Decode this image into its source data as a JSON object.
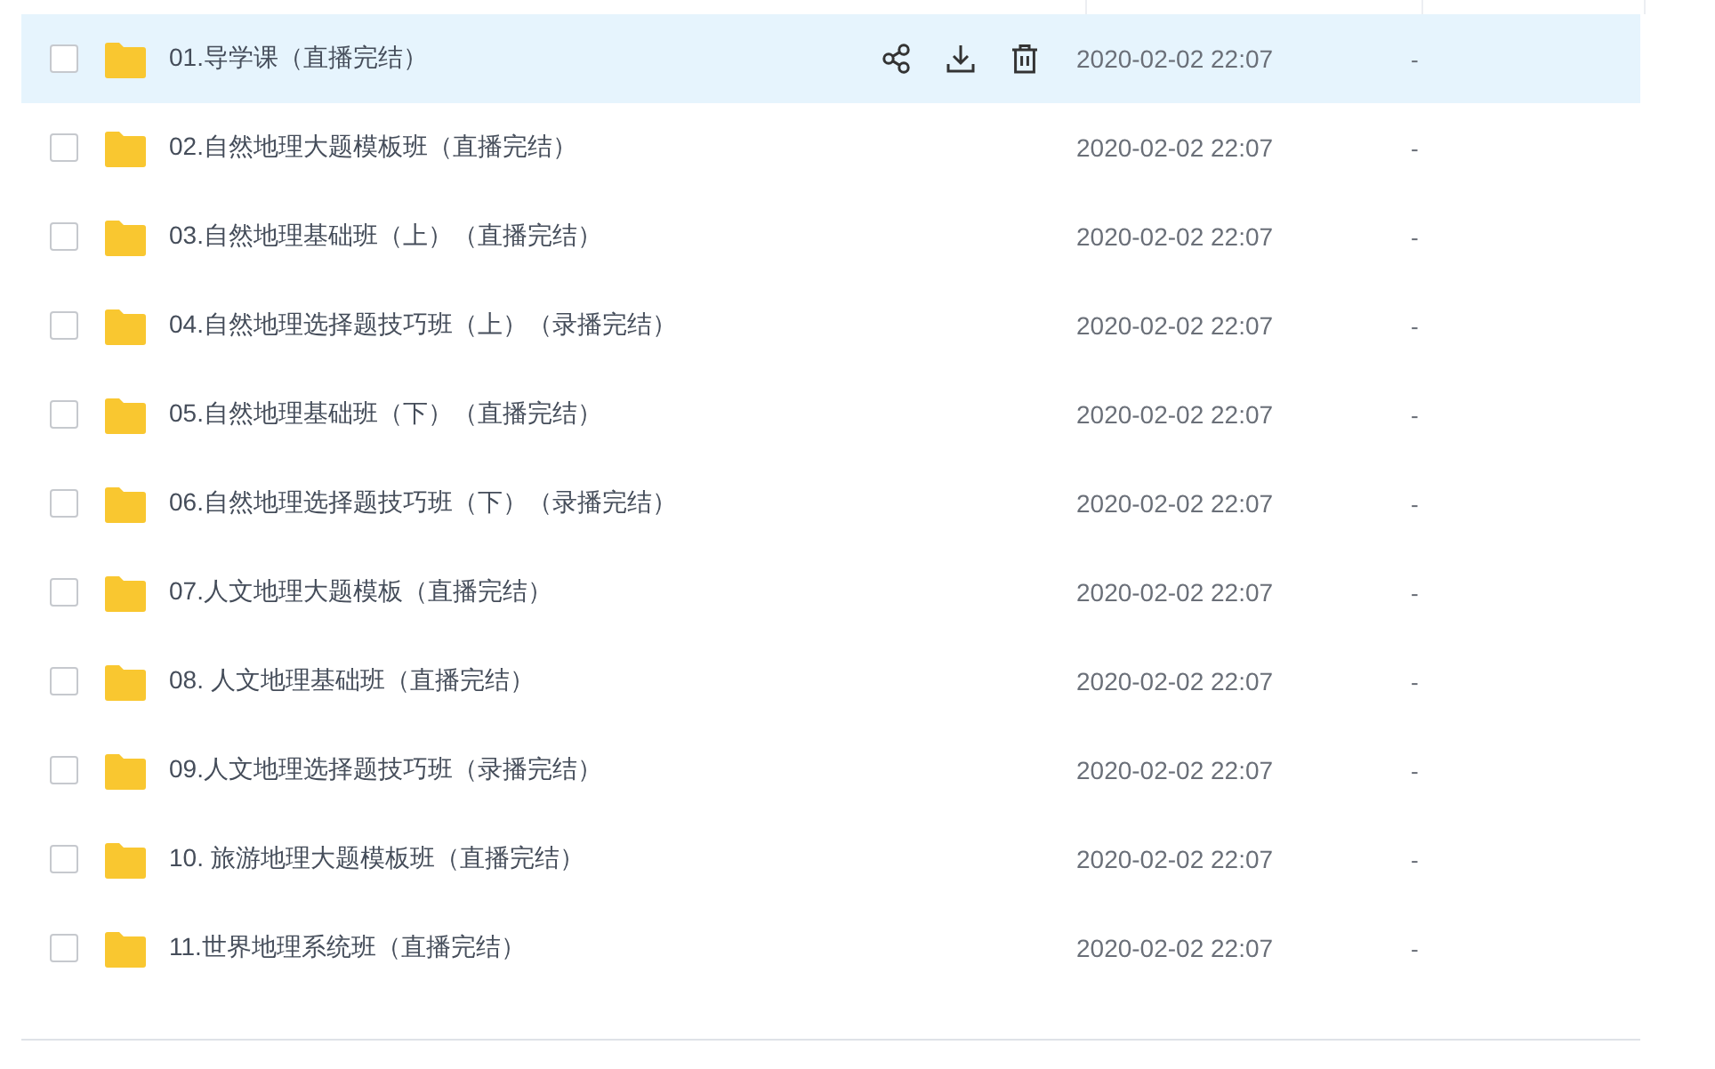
{
  "files": [
    {
      "name": "01.导学课（直播完结）",
      "modified": "2020-02-02 22:07",
      "size": "-",
      "checked": false,
      "selected": true
    },
    {
      "name": "02.自然地理大题模板班（直播完结）",
      "modified": "2020-02-02 22:07",
      "size": "-",
      "checked": false,
      "selected": false
    },
    {
      "name": "03.自然地理基础班（上）（直播完结）",
      "modified": "2020-02-02 22:07",
      "size": "-",
      "checked": false,
      "selected": false
    },
    {
      "name": "04.自然地理选择题技巧班（上）（录播完结）",
      "modified": "2020-02-02 22:07",
      "size": "-",
      "checked": false,
      "selected": false
    },
    {
      "name": "05.自然地理基础班（下）（直播完结）",
      "modified": "2020-02-02 22:07",
      "size": "-",
      "checked": false,
      "selected": false
    },
    {
      "name": "06.自然地理选择题技巧班（下）（录播完结）",
      "modified": "2020-02-02 22:07",
      "size": "-",
      "checked": false,
      "selected": false
    },
    {
      "name": "07.人文地理大题模板（直播完结）",
      "modified": "2020-02-02 22:07",
      "size": "-",
      "checked": false,
      "selected": false
    },
    {
      "name": "08. 人文地理基础班（直播完结）",
      "modified": "2020-02-02 22:07",
      "size": "-",
      "checked": false,
      "selected": false
    },
    {
      "name": "09.人文地理选择题技巧班（录播完结）",
      "modified": "2020-02-02 22:07",
      "size": "-",
      "checked": false,
      "selected": false
    },
    {
      "name": "10. 旅游地理大题模板班（直播完结）",
      "modified": "2020-02-02 22:07",
      "size": "-",
      "checked": false,
      "selected": false
    },
    {
      "name": "11.世界地理系统班（直播完结）",
      "modified": "2020-02-02 22:07",
      "size": "-",
      "checked": false,
      "selected": false
    }
  ]
}
